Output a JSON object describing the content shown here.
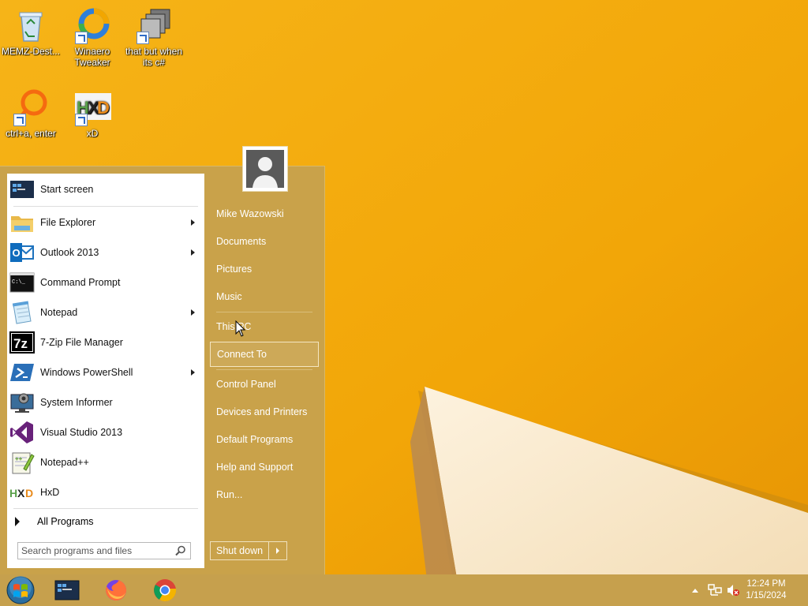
{
  "desktop": {
    "icons": [
      {
        "label": "MEMZ-Dest..."
      },
      {
        "label": "Winaero Tweaker"
      },
      {
        "label": "that but when its c#"
      },
      {
        "label": "ctrl+a, enter"
      },
      {
        "label": "xD"
      }
    ]
  },
  "start_menu": {
    "programs": [
      {
        "label": "Start screen",
        "has_submenu": false
      },
      {
        "label": "File Explorer",
        "has_submenu": true
      },
      {
        "label": "Outlook 2013",
        "has_submenu": true
      },
      {
        "label": "Command Prompt",
        "has_submenu": false
      },
      {
        "label": "Notepad",
        "has_submenu": true
      },
      {
        "label": "7-Zip File Manager",
        "has_submenu": false
      },
      {
        "label": "Windows PowerShell",
        "has_submenu": true
      },
      {
        "label": "System Informer",
        "has_submenu": false
      },
      {
        "label": "Visual Studio 2013",
        "has_submenu": false
      },
      {
        "label": "Notepad++",
        "has_submenu": false
      },
      {
        "label": "HxD",
        "has_submenu": false
      }
    ],
    "all_programs_label": "All Programs",
    "search": {
      "placeholder": "Search programs and files"
    },
    "right_links": [
      {
        "label": "Mike Wazowski"
      },
      {
        "label": "Documents"
      },
      {
        "label": "Pictures"
      },
      {
        "label": "Music"
      },
      {
        "label": "This PC"
      },
      {
        "label": "Connect To",
        "active": true
      },
      {
        "label": "Control Panel"
      },
      {
        "label": "Devices and Printers"
      },
      {
        "label": "Default Programs"
      },
      {
        "label": "Help and Support"
      },
      {
        "label": "Run..."
      }
    ],
    "shutdown_label": "Shut down"
  },
  "taskbar": {
    "clock": {
      "time": "12:24 PM",
      "date": "1/15/2024"
    }
  },
  "colors": {
    "wallpaper": "#f2a708",
    "menu_bg": "#c9a24a",
    "taskbar_bg": "#c6a04d"
  }
}
